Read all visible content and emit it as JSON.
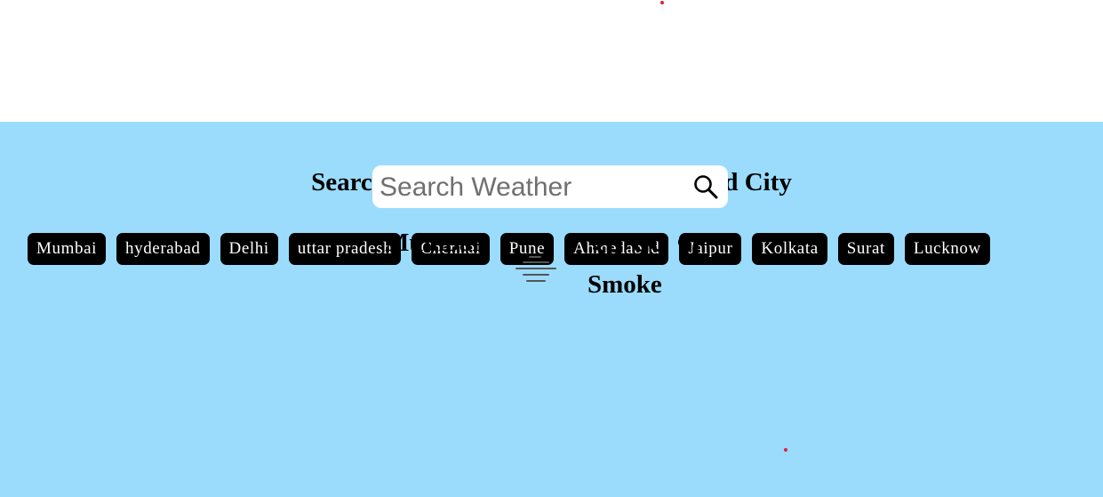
{
  "heading": "Search Weather All Over Country And City",
  "cities": [
    "Mumbai",
    "hyderabad",
    "Delhi",
    "uttar pradesh",
    "Chennai",
    "Pune",
    "Ahmedabad",
    "Jaipur",
    "Kolkata",
    "Surat",
    "Lucknow"
  ],
  "search": {
    "placeholder": "Search Weather",
    "value": "",
    "icon": "search-icon"
  },
  "weather": {
    "city": "Mumbai",
    "temperature": "30.99 °C",
    "condition": "Smoke",
    "icon": "haze-icon"
  },
  "colors": {
    "panel_bg": "#9bdcfd",
    "button_bg": "#000000",
    "button_text": "#ffffff",
    "dot": "#e0203a"
  }
}
